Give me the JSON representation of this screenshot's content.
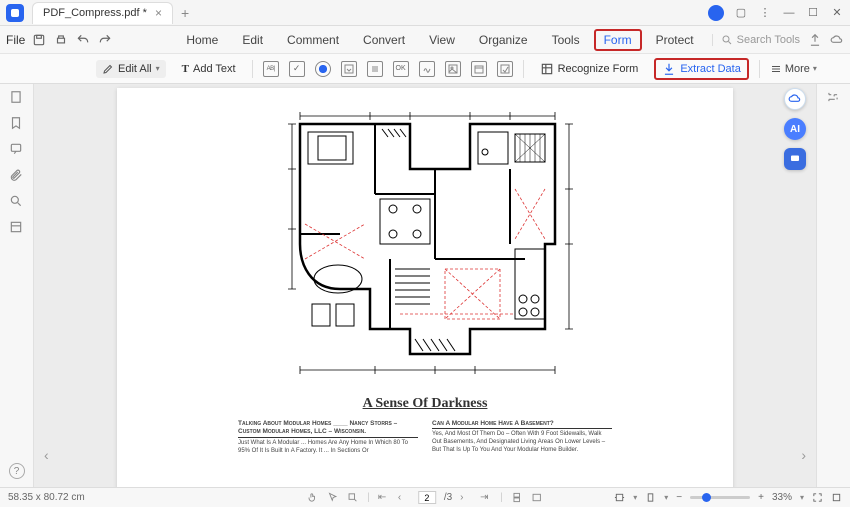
{
  "titlebar": {
    "tab_name": "PDF_Compress.pdf *"
  },
  "menu": {
    "file": "File",
    "items": [
      "Home",
      "Edit",
      "Comment",
      "Convert",
      "View",
      "Organize",
      "Tools",
      "Form",
      "Protect"
    ],
    "active_index": 7,
    "search_placeholder": "Search Tools"
  },
  "toolbar": {
    "edit_all": "Edit All",
    "add_text": "Add Text",
    "field_icons": [
      "ABI",
      "check",
      "radio",
      "combo",
      "list",
      "button",
      "sign",
      "image",
      "date",
      "barcode"
    ],
    "recognize": "Recognize Form",
    "extract": "Extract Data",
    "more": "More"
  },
  "document": {
    "heading": "A Sense Of Darkness",
    "col1_header": "Talking About Modular Homes ____ Nancy Storrs – Custom Modular Homes, LLC – Wisconsin.",
    "col1_body": "Just What Is A Modular ... Homes Are Any Home In Which 80 To 95% Of It Is Built In A Factory. It ... In Sections Or",
    "col2_header": "Can A Modular Home Have A Basement?",
    "col2_body": "Yes, And Most Of Them Do – Often With 9 Foot Sidewalls, Walk Out Basements, And Designated Living Areas On Lower Levels – But That Is Up To You And Your Modular Home Builder."
  },
  "status": {
    "dimensions": "58.35 x 80.72 cm",
    "page_current": "2",
    "page_total": "/3",
    "zoom": "33%"
  }
}
